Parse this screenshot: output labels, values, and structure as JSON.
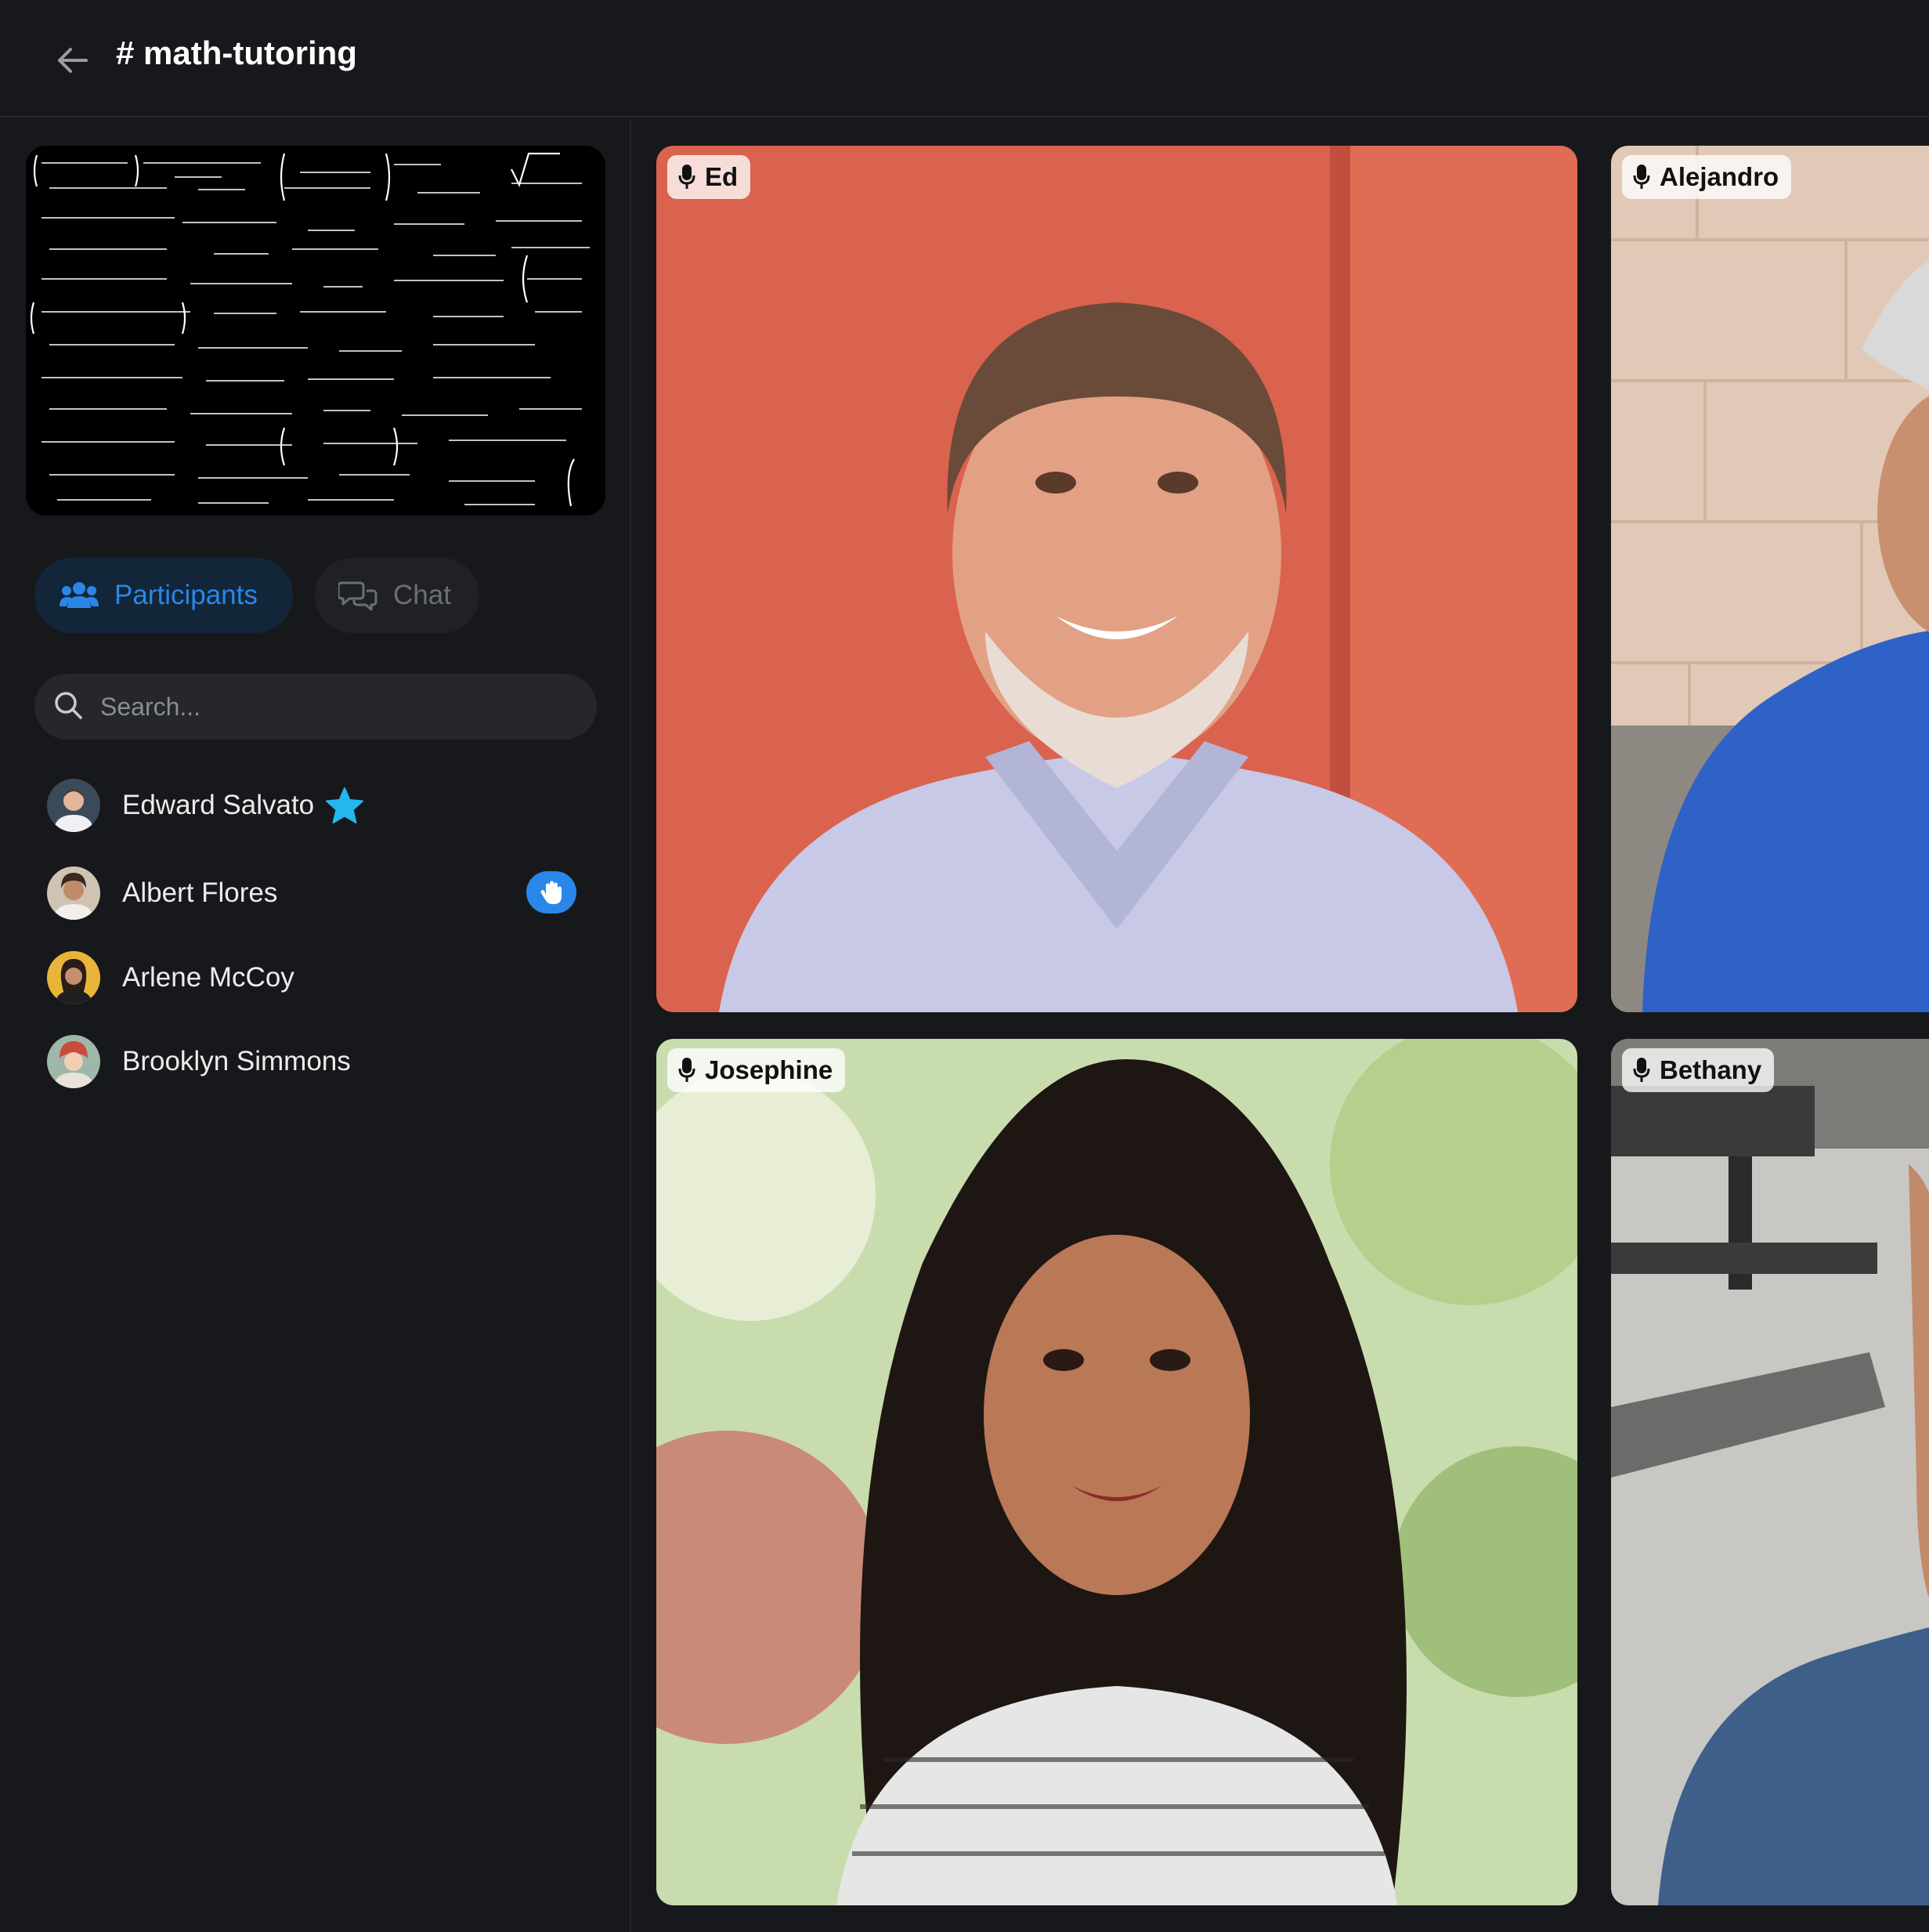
{
  "header": {
    "title": "# math-tutoring"
  },
  "sidebar": {
    "tabs": [
      {
        "label": "Participants",
        "icon": "users-icon",
        "active": true
      },
      {
        "label": "Chat",
        "icon": "chat-bubbles-icon",
        "active": false
      }
    ],
    "search": {
      "placeholder": "Search...",
      "value": ""
    },
    "participants": [
      {
        "name": "Edward Salvato",
        "badge": "star-icon",
        "host": true
      },
      {
        "name": "Albert Flores",
        "badge": "raised-hand-icon"
      },
      {
        "name": "Arlene McCoy"
      },
      {
        "name": "Brooklyn Simmons"
      }
    ]
  },
  "video_tiles": [
    {
      "name": "Ed",
      "icon": "microphone-icon"
    },
    {
      "name": "Alejandro",
      "icon": "microphone-icon"
    },
    {
      "name": "Josephine",
      "icon": "microphone-icon"
    },
    {
      "name": "Bethany",
      "icon": "microphone-icon"
    }
  ],
  "colors": {
    "background": "#17181b",
    "accent": "#2a86e8",
    "star": "#22b8ee"
  }
}
